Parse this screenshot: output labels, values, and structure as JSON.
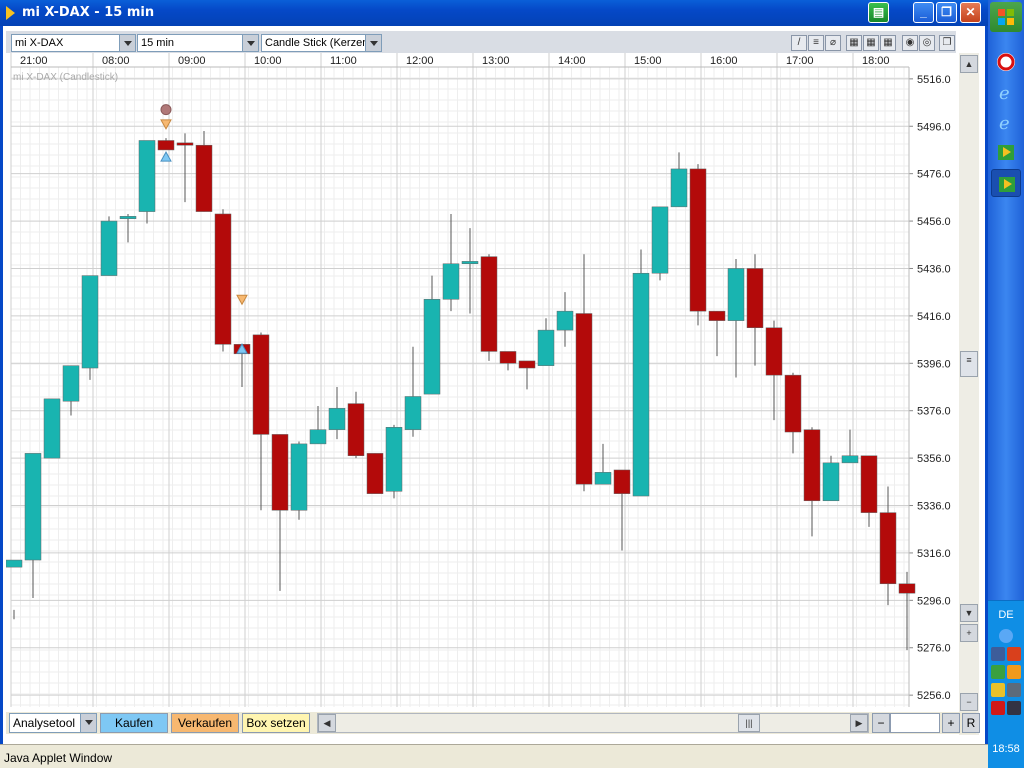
{
  "window": {
    "title": "mi X-DAX - 15 min",
    "status": "Java Applet Window"
  },
  "toolbar": {
    "instrument": "mi X-DAX",
    "interval": "15 min",
    "chart_type": "Candle Stick (Kerzen"
  },
  "chart_label": "mi X-DAX (Candlestick)",
  "bottom": {
    "analysis_tool": "Analysetool",
    "buy": "Kaufen",
    "sell": "Verkaufen",
    "box": "Box setzen",
    "reset": "R"
  },
  "taskbar": {
    "language": "DE",
    "clock": "18:58"
  },
  "colors": {
    "up": "#19b4b0",
    "down": "#b30a0a",
    "buy": "#7ec8f4",
    "sell": "#f7b870",
    "box": "#fff5b0"
  },
  "chart_data": {
    "type": "candlestick",
    "title": "",
    "time_labels": [
      "21:00",
      "08:00",
      "09:00",
      "10:00",
      "11:00",
      "12:00",
      "13:00",
      "14:00",
      "15:00",
      "16:00",
      "17:00",
      "18:00"
    ],
    "y_ticks": [
      "5516.0",
      "5496.0",
      "5476.0",
      "5456.0",
      "5436.0",
      "5416.0",
      "5396.0",
      "5376.0",
      "5356.0",
      "5336.0",
      "5316.0",
      "5296.0",
      "5276.0",
      "5256.0"
    ],
    "ylim": [
      5251,
      5521
    ],
    "grid": true,
    "candles": [
      [
        5310,
        5313,
        5288,
        5292
      ],
      [
        5313,
        5358,
        5297,
        5357
      ],
      [
        5356,
        5381,
        5356,
        5381
      ],
      [
        5380,
        5395,
        5374,
        5395
      ],
      [
        5394,
        5433,
        5389,
        5433
      ],
      [
        5433,
        5456,
        5433,
        5458
      ],
      [
        5457,
        5458,
        5447,
        5459
      ],
      [
        5460,
        5490,
        5455,
        5490
      ],
      [
        5490,
        5486,
        5487,
        5491
      ],
      [
        5489,
        5488,
        5464,
        5493
      ],
      [
        5488,
        5460,
        5460,
        5494
      ],
      [
        5459,
        5404,
        5401,
        5461
      ],
      [
        5404,
        5400,
        5386,
        5404
      ],
      [
        5408,
        5366,
        5334,
        5409
      ],
      [
        5366,
        5334,
        5300,
        5366
      ],
      [
        5334,
        5362,
        5330,
        5363
      ],
      [
        5362,
        5368,
        5362,
        5378
      ],
      [
        5368,
        5377,
        5364,
        5386
      ],
      [
        5379,
        5357,
        5356,
        5384
      ],
      [
        5358,
        5341,
        5341,
        5358
      ],
      [
        5342,
        5369,
        5339,
        5370
      ],
      [
        5368,
        5382,
        5365,
        5403
      ],
      [
        5383,
        5423,
        5383,
        5433
      ],
      [
        5423,
        5438,
        5418,
        5459
      ],
      [
        5438,
        5439,
        5417,
        5453
      ],
      [
        5441,
        5401,
        5397,
        5442
      ],
      [
        5401,
        5396,
        5393,
        5401
      ],
      [
        5397,
        5394,
        5385,
        5395
      ],
      [
        5395,
        5410,
        5395,
        5415
      ],
      [
        5410,
        5418,
        5403,
        5426
      ],
      [
        5417,
        5345,
        5342,
        5442
      ],
      [
        5345,
        5350,
        5348,
        5362
      ],
      [
        5351,
        5341,
        5317,
        5351
      ],
      [
        5340,
        5434,
        5340,
        5444
      ],
      [
        5434,
        5462,
        5431,
        5462
      ],
      [
        5462,
        5478,
        5462,
        5485
      ],
      [
        5478,
        5418,
        5412,
        5480
      ],
      [
        5418,
        5414,
        5399,
        5418
      ],
      [
        5414,
        5436,
        5390,
        5440
      ],
      [
        5436,
        5411,
        5395,
        5442
      ],
      [
        5411,
        5391,
        5372,
        5414
      ],
      [
        5391,
        5367,
        5358,
        5392
      ],
      [
        5368,
        5338,
        5323,
        5369
      ],
      [
        5338,
        5354,
        5338,
        5357
      ],
      [
        5354,
        5357,
        5355,
        5368
      ],
      [
        5357,
        5333,
        5327,
        5357
      ],
      [
        5333,
        5303,
        5294,
        5344
      ],
      [
        5303,
        5299,
        5275,
        5308
      ]
    ],
    "markers": [
      {
        "candle": 8,
        "kind": "circle",
        "price": 5503
      },
      {
        "candle": 8,
        "kind": "triangle-down",
        "price": 5497
      },
      {
        "candle": 8,
        "kind": "triangle-up",
        "price": 5483
      },
      {
        "candle": 12,
        "kind": "triangle-down",
        "price": 5423
      },
      {
        "candle": 12,
        "kind": "triangle-up",
        "price": 5402
      }
    ]
  }
}
